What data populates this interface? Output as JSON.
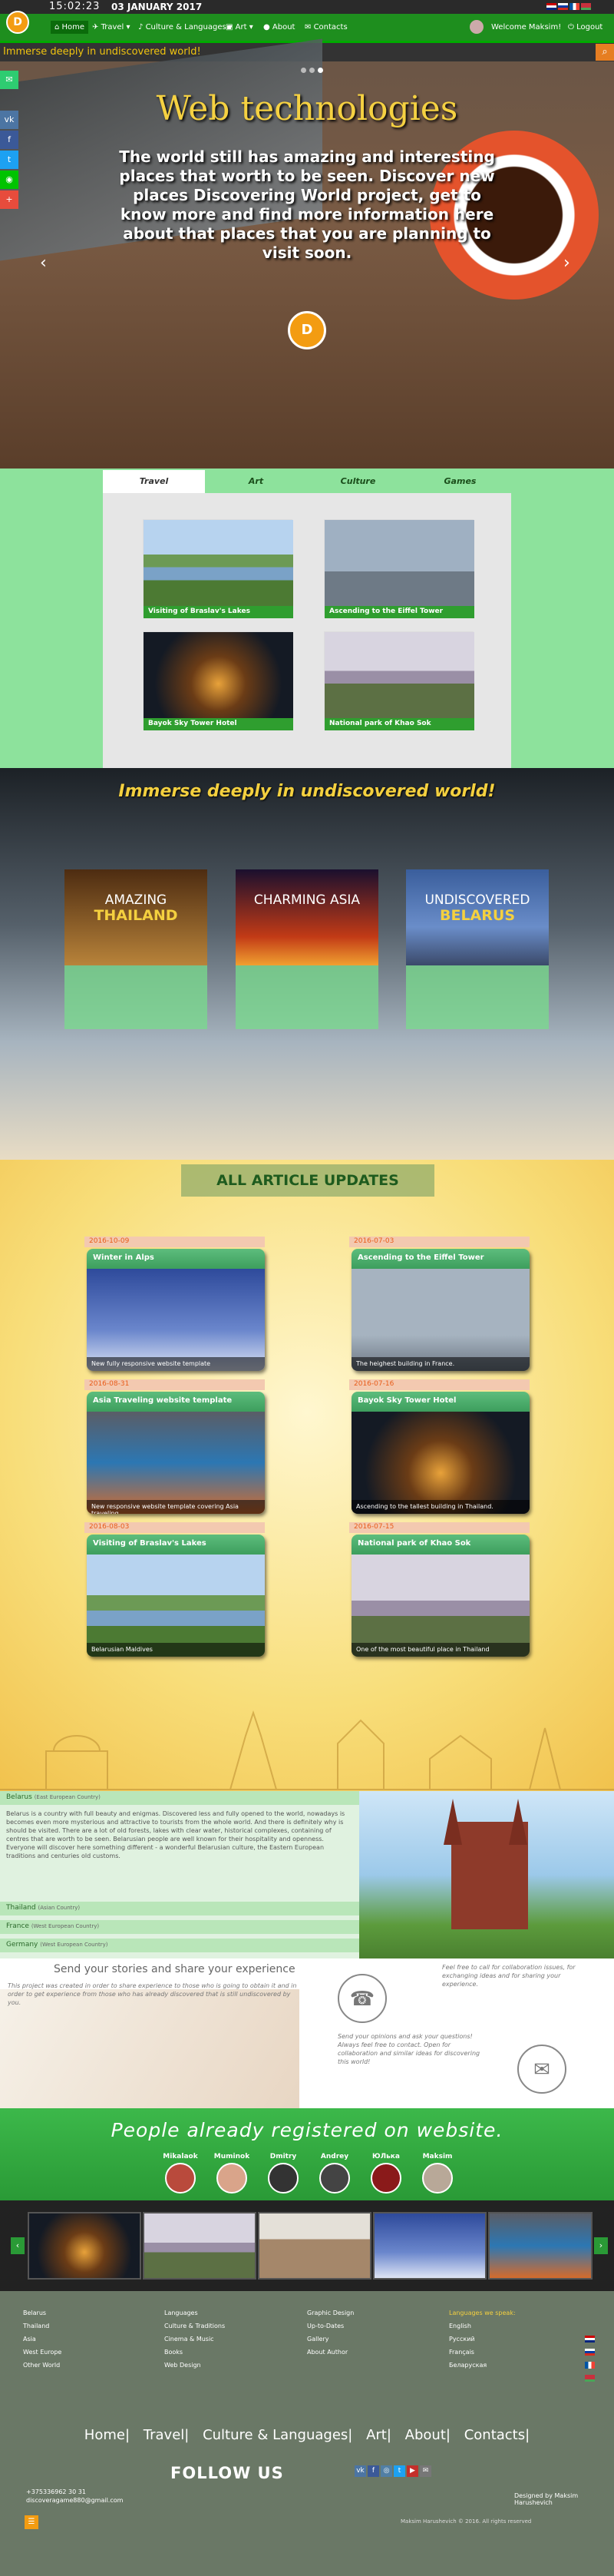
{
  "topbar": {
    "time": "15:02:23",
    "date": "03 JANUARY 2017"
  },
  "logo": {
    "glyph": "D"
  },
  "nav": {
    "home": "Home",
    "travel": "Travel ▾",
    "culture": "Culture & Languages ▾",
    "art": "Art ▾",
    "about": "About",
    "contacts": "Contacts",
    "welcome": "Welcome Maksim!",
    "logout": "Logout"
  },
  "ticker": "Immerse deeply in undiscovered world!",
  "hero": {
    "title": "Web technologies",
    "text": "The world still has amazing and interesting places that worth to be seen. Discover new places Discovering World project, get to know more and find more information here about that places that you are planning to visit soon.",
    "badge": "D"
  },
  "tabs": [
    "Travel",
    "Art",
    "Culture",
    "Games"
  ],
  "travel_cards": [
    {
      "caption": "Visiting of Braslav's Lakes"
    },
    {
      "caption": "Ascending to the Eiffel Tower"
    },
    {
      "caption": "Bayok Sky Tower Hotel"
    },
    {
      "caption": "National park of Khao Sok"
    }
  ],
  "immerse": {
    "title": "Immerse deeply in undiscovered world!",
    "destinations": [
      {
        "line1": "AMAZING",
        "line2": "THAILAND"
      },
      {
        "line1": "CHARMING ASIA",
        "line2": ""
      },
      {
        "line1": "UNDISCOVERED",
        "line2": "BELARUS"
      }
    ]
  },
  "articles": {
    "title": "ALL ARTICLE UPDATES",
    "items": [
      {
        "date": "2016-10-09",
        "title": "Winter in Alps",
        "desc": "New fully responsive website template"
      },
      {
        "date": "2016-07-03",
        "title": "Ascending to the Eiffel Tower",
        "desc": "The heighest building in France."
      },
      {
        "date": "2016-08-31",
        "title": "Asia Traveling website template",
        "desc": "New responsive website template covering Asia traveling"
      },
      {
        "date": "2016-07-16",
        "title": "Bayok Sky Tower Hotel",
        "desc": "Ascending to the tallest building in Thailand."
      },
      {
        "date": "2016-08-03",
        "title": "Visiting of Braslav's Lakes",
        "desc": "Belarusian Maldives"
      },
      {
        "date": "2016-07-15",
        "title": "National park of Khao Sok",
        "desc": "One of the most beautiful place in Thailand"
      }
    ]
  },
  "countries": {
    "items": [
      {
        "name": "Belarus",
        "tag": "(East European Country)"
      },
      {
        "name": "Thailand",
        "tag": "(Asian Country)"
      },
      {
        "name": "France",
        "tag": "(West European Country)"
      },
      {
        "name": "Germany",
        "tag": "(West European Country)"
      }
    ],
    "text": "Belarus is a country with full beauty and enigmas. Discovered less and fully opened to the world, nowadays is becomes even more mysterious and attractive to tourists from the whole world. And there is definitely why is should be visited. There are a lot of old forests, lakes with clear water, historical complexes, containing of centres that are worth to be seen. Belarusian people are well known for their hospitality and openness. Everyone will discover here something different - a wonderful Belarusian culture, the Eastern European traditions and centuries old customs."
  },
  "contact": {
    "title": "Send your stories and share your experience",
    "text": "This project was created in order to share experience to those who is going to obtain it and in order to get experience from those who has already discovered that is still undiscovered by you.",
    "call_text": "Feel free to call for collaboration issues, for exchanging ideas and for sharing your experience.",
    "mail_text": "Send your opinions and ask your questions! Always feel free to contact. Open for collaboration and similar ideas for discovering this world!"
  },
  "registered": {
    "title": "People already registered on website.",
    "users": [
      "Mikalaok",
      "Muminok",
      "Dmitry",
      "Andrey",
      "ЮЛька",
      "Maksim"
    ]
  },
  "footer": {
    "col1": [
      "Belarus",
      "Thailand",
      "Asia",
      "West Europe",
      "Other World"
    ],
    "col2": [
      "Languages",
      "Culture & Traditions",
      "Cinema & Music",
      "Books",
      "Web Design"
    ],
    "col3": [
      "Graphic Design",
      "Up-to-Dates",
      "Gallery",
      "About Author"
    ],
    "lang_head": "Languages we speak:",
    "langs": [
      "English",
      "Русский",
      "Français",
      "Беларуская"
    ],
    "nav": [
      "Home|",
      "Travel|",
      "Culture & Languages|",
      "Art|",
      "About|",
      "Contacts|"
    ],
    "follow": "FOLLOW US",
    "phone": "+375336962 30 31",
    "email": "discoveragame880@gmail.com",
    "designed": "Designed by Maksim Harushevich",
    "copyright": "Maksim Harushevich © 2016. All rights reserved"
  },
  "colors": {
    "nav_green": "#1e8e1e",
    "accent_orange": "#f39c12",
    "tab_green": "#8de29c",
    "footer": "#6a7866"
  }
}
